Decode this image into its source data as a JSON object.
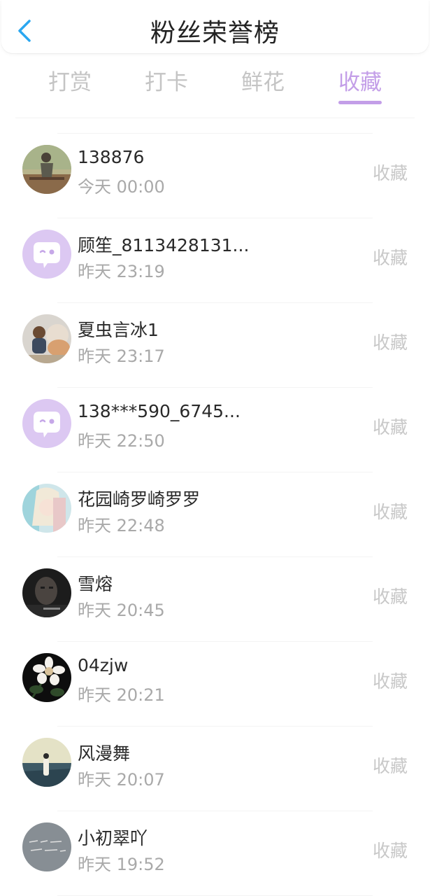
{
  "header": {
    "title": "粉丝荣誉榜",
    "back_icon": "chevron-left-icon",
    "accent_color": "#2aa7f0"
  },
  "tabs": [
    {
      "label": "打赏",
      "active": false
    },
    {
      "label": "打卡",
      "active": false
    },
    {
      "label": "鲜花",
      "active": false
    },
    {
      "label": "收藏",
      "active": true
    }
  ],
  "active_color": "#c39ee8",
  "fans": [
    {
      "name": "138876",
      "time": "今天 00:00",
      "action": "收藏",
      "avatar": "photo-sitting-figure"
    },
    {
      "name": "顾笙_8113428131...",
      "time": "昨天 23:19",
      "action": "收藏",
      "avatar": "default-chat-bubble"
    },
    {
      "name": "夏虫言冰1",
      "time": "昨天 23:17",
      "action": "收藏",
      "avatar": "photo-child-with-dog"
    },
    {
      "name": "138***590_6745...",
      "time": "昨天 22:50",
      "action": "收藏",
      "avatar": "default-chat-bubble"
    },
    {
      "name": "花园崎罗崎罗罗",
      "time": "昨天 22:48",
      "action": "收藏",
      "avatar": "anime-girl"
    },
    {
      "name": "雪熔",
      "time": "昨天 20:45",
      "action": "收藏",
      "avatar": "dark-portrait"
    },
    {
      "name": "04zjw",
      "time": "昨天 20:21",
      "action": "收藏",
      "avatar": "white-flower"
    },
    {
      "name": "风漫舞",
      "time": "昨天 20:07",
      "action": "收藏",
      "avatar": "girl-in-field"
    },
    {
      "name": "小初翠吖",
      "time": "昨天 19:52",
      "action": "收藏",
      "avatar": "handwriting-gray"
    }
  ]
}
